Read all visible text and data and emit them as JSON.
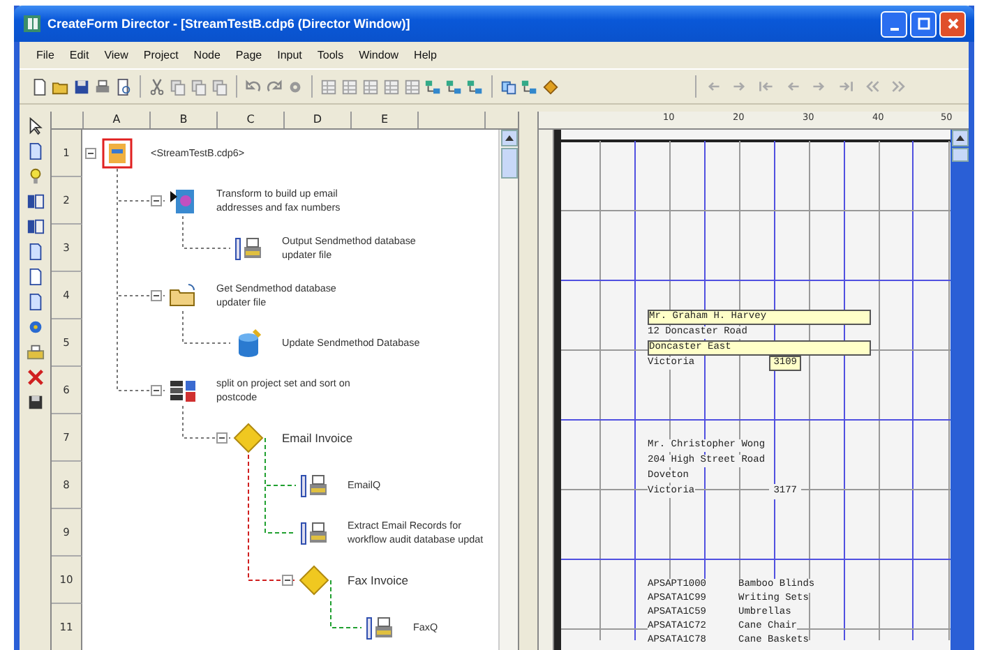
{
  "window": {
    "title": "CreateForm Director - [StreamTestB.cdp6 (Director Window)]"
  },
  "menu": [
    "File",
    "Edit",
    "View",
    "Project",
    "Node",
    "Page",
    "Input",
    "Tools",
    "Window",
    "Help"
  ],
  "sheet": {
    "columns": [
      "A",
      "B",
      "C",
      "D",
      "E"
    ],
    "rows": [
      "1",
      "2",
      "3",
      "4",
      "5",
      "6",
      "7",
      "8",
      "9",
      "10",
      "11"
    ]
  },
  "workflow": {
    "label": "<StreamTestB.cdp6>",
    "kind": "project",
    "children": [
      {
        "label": "Transform to build up email\naddresses and fax numbers",
        "kind": "transform",
        "children": [
          {
            "label": "Output Sendmethod database\nupdater file",
            "kind": "output"
          }
        ]
      },
      {
        "label": "Get Sendmethod database\nupdater file",
        "kind": "input",
        "children": [
          {
            "label": "Update Sendmethod Database",
            "kind": "database"
          }
        ]
      },
      {
        "label": "split on project set and sort on\npostcode",
        "kind": "split",
        "children": [
          {
            "label": "Email Invoice",
            "kind": "condition",
            "children": [
              {
                "label": "EmailQ",
                "kind": "output"
              },
              {
                "label": "Extract Email Records for\nworkflow audit database updat",
                "kind": "output"
              },
              {
                "label": "Fax Invoice",
                "kind": "condition",
                "children": [
                  {
                    "label": "FaxQ",
                    "kind": "output"
                  }
                ]
              }
            ]
          }
        ]
      }
    ]
  },
  "preview": {
    "ruler": [
      "10",
      "20",
      "30",
      "40",
      "50"
    ],
    "records": [
      {
        "lines": [
          {
            "text": "Mr. Graham H. Harvey",
            "highlighted": true
          },
          {
            "text": "12 Doncaster Road",
            "highlighted": false
          },
          {
            "text": "Doncaster East",
            "highlighted": true
          },
          {
            "text": "Victoria",
            "highlighted": false
          }
        ],
        "postcode": {
          "text": "3109",
          "highlighted": true
        }
      },
      {
        "lines": [
          {
            "text": "Mr. Christopher Wong",
            "highlighted": false
          },
          {
            "text": "204 High Street Road",
            "highlighted": false
          },
          {
            "text": "Doveton",
            "highlighted": false
          },
          {
            "text": "Victoria",
            "highlighted": false
          }
        ],
        "postcode": {
          "text": "3177",
          "highlighted": false
        }
      }
    ],
    "items": [
      {
        "code": "APSAPT1000",
        "description": "Bamboo Blinds"
      },
      {
        "code": "APSATA1C99",
        "description": "Writing Sets"
      },
      {
        "code": "APSATA1C59",
        "description": "Umbrellas"
      },
      {
        "code": "APSATA1C72",
        "description": "Cane Chair"
      },
      {
        "code": "APSATA1C78",
        "description": "Cane Baskets"
      }
    ]
  }
}
